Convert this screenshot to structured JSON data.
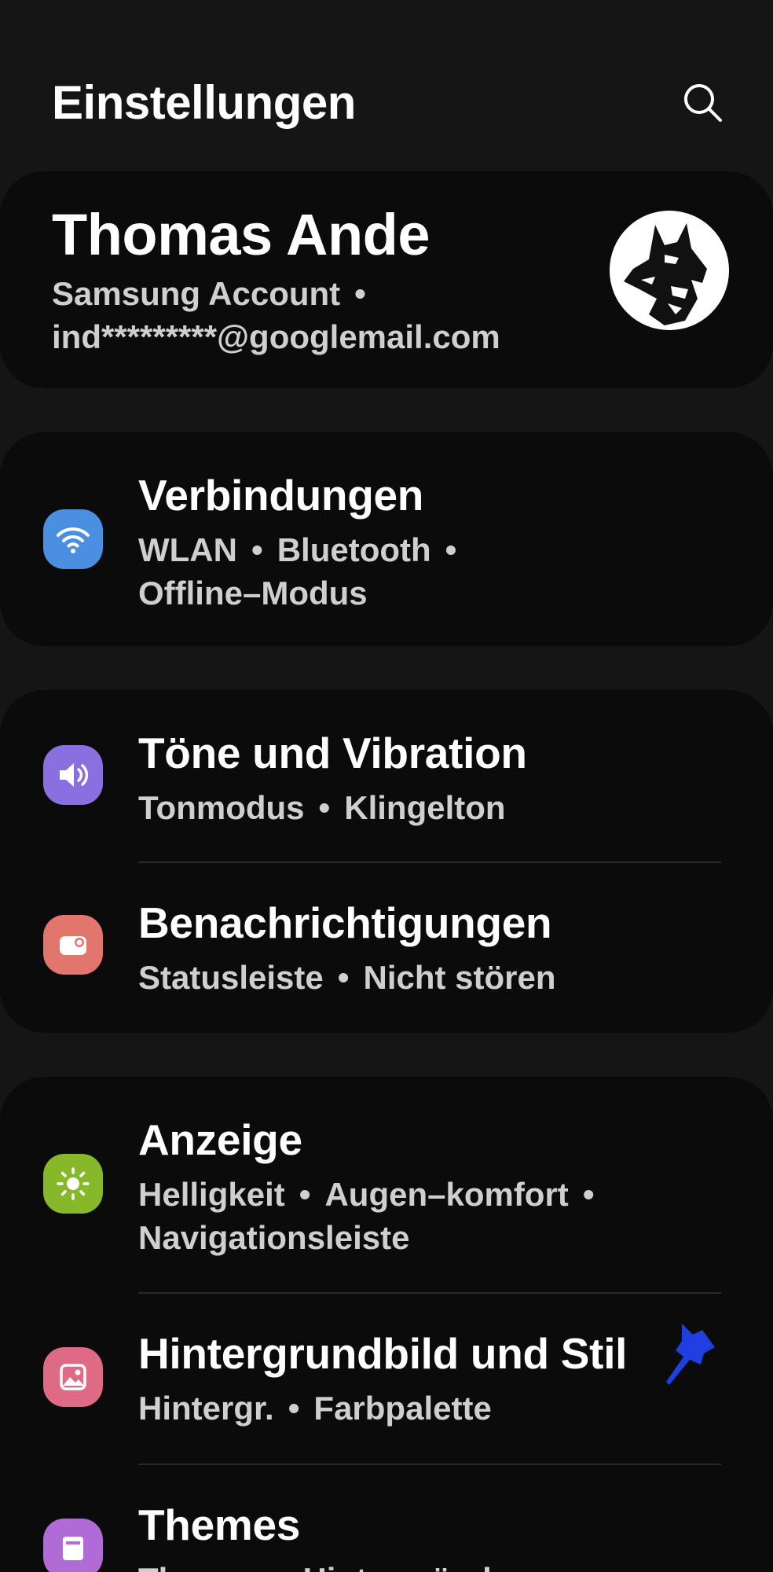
{
  "header": {
    "title": "Einstellungen",
    "search_icon": "search-icon"
  },
  "profile": {
    "name": "Thomas Ande",
    "account_label": "Samsung Account",
    "email": "ind*********@googlemail.com",
    "avatar_icon": "wolf-avatar-icon"
  },
  "items": [
    {
      "title": "Verbindungen",
      "sub": [
        "WLAN",
        "Bluetooth",
        "Offline–Modus"
      ],
      "icon": "wifi-icon",
      "color": "#4a8fe0"
    },
    {
      "title": "Töne und Vibration",
      "sub": [
        "Tonmodus",
        "Klingelton"
      ],
      "icon": "volume-icon",
      "color": "#8a6fe0"
    },
    {
      "title": "Benachrichtigungen",
      "sub": [
        "Statusleiste",
        "Nicht stören"
      ],
      "icon": "notification-icon",
      "color": "#e2766c"
    },
    {
      "title": "Anzeige",
      "sub": [
        "Helligkeit",
        "Augen–komfort",
        "Navigationsleiste"
      ],
      "icon": "brightness-icon",
      "color": "#86b82a"
    },
    {
      "title": "Hintergrundbild und Stil",
      "sub": [
        "Hintergr.",
        "Farbpalette"
      ],
      "icon": "wallpaper-icon",
      "color": "#df6a86"
    },
    {
      "title": "Themes",
      "sub": [
        "Themes",
        "Hintergründe"
      ],
      "icon": "themes-icon",
      "color": "#b06bd6"
    }
  ],
  "separator": "•",
  "colors": {
    "background": "#151515",
    "card": "#0b0b0b",
    "subtext": "#cfcfcf",
    "pin": "#1f3fe0"
  }
}
